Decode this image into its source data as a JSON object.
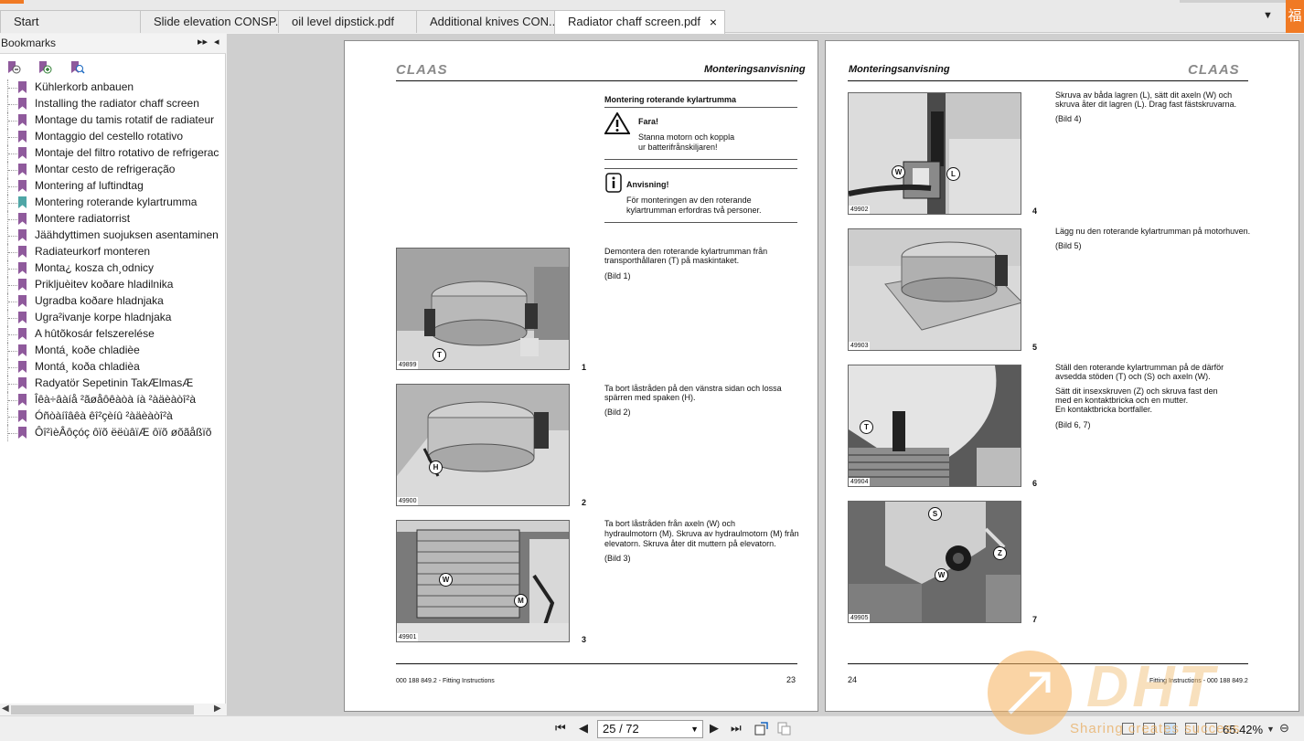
{
  "tabs": [
    {
      "label": "Start",
      "active": false
    },
    {
      "label": "Slide elevation CONSP...",
      "active": false
    },
    {
      "label": "oil level dipstick.pdf",
      "active": false
    },
    {
      "label": "Additional knives CON...",
      "active": false
    },
    {
      "label": "Radiator chaff screen.pdf",
      "active": true
    }
  ],
  "tab_close_icon": "×",
  "tab_list_icon": "▼",
  "brand_badge": "福",
  "sidebar": {
    "title": "Bookmarks",
    "expand_icon": "▸▸",
    "collapse_icon": "◂",
    "tools": [
      "bookmark-delete-icon",
      "bookmark-add-icon",
      "bookmark-find-icon"
    ],
    "items": [
      {
        "label": "Kühlerkorb anbauen"
      },
      {
        "label": "Installing the radiator chaff screen"
      },
      {
        "label": "Montage du tamis rotatif de radiateur"
      },
      {
        "label": "Montaggio del cestello rotativo"
      },
      {
        "label": "Montaje del filtro rotativo de refrigerac"
      },
      {
        "label": "Montar cesto de refrigeração"
      },
      {
        "label": "Montering af luftindtag"
      },
      {
        "label": "Montering roterande kylartrumma",
        "current": true
      },
      {
        "label": "Montere radiatorrist"
      },
      {
        "label": "Jäähdyttimen suojuksen asentaminen"
      },
      {
        "label": "Radiateurkorf monteren"
      },
      {
        "label": "Monta¿ kosza ch¸odnicy"
      },
      {
        "label": "Prikljuèitev koðare hladilnika"
      },
      {
        "label": "Ugradba koðare hladnjaka"
      },
      {
        "label": "Ugra²ivanje korpe hladnjaka"
      },
      {
        "label": "A hûtõkosár felszerelése"
      },
      {
        "label": "Montá¸ koðe chladièe"
      },
      {
        "label": "Montá¸ koða chladièa"
      },
      {
        "label": "Radyatör Sepetinin TakÆlmasÆ"
      },
      {
        "label": "Îêà÷âàíå ²ãøåôêàòà íà ²àäèàòî²à"
      },
      {
        "label": "Óñòàíîâêà êî²çèíû ²àäèàòî²à"
      },
      {
        "label": "Ôî²ìèÂôçóç ôïõ ëëùâïÆ ôïõ øõãåßïõ"
      }
    ]
  },
  "page_left": {
    "logo": "CLAAS",
    "header": "Monteringsanvisning",
    "section_title": "Montering roterande kylartrumma",
    "warning_title": "Fara!",
    "warning_text": [
      "Stanna motorn och koppla",
      "ur batterifrånskiljaren!"
    ],
    "note_title": "Anvisning!",
    "note_text": [
      "För monteringen av den roterande",
      "kylartrumman erfordras två personer."
    ],
    "steps": [
      {
        "text": [
          "Demontera den roterande kylartrumman från",
          "transporthållaren (T) på maskintaket."
        ],
        "ref": "(Bild 1)",
        "photo_id": "49899",
        "fig": "1",
        "callouts": [
          "T"
        ]
      },
      {
        "text": [
          "Ta bort låstråden på den vänstra sidan och lossa",
          "spärren med spaken (H)."
        ],
        "ref": "(Bild 2)",
        "photo_id": "49900",
        "fig": "2",
        "callouts": [
          "H"
        ]
      },
      {
        "text": [
          "Ta bort låstråden från axeln (W) och",
          "hydraulmotorn (M). Skruva av hydraulmotorn (M) från",
          "elevatorn. Skruva åter dit muttern på elevatorn."
        ],
        "ref": "(Bild 3)",
        "photo_id": "49901",
        "fig": "3",
        "callouts": [
          "W",
          "M"
        ]
      }
    ],
    "footer_left": "000 188 849.2 - Fitting Instructions",
    "page_number": "23"
  },
  "page_right": {
    "logo": "CLAAS",
    "header": "Monteringsanvisning",
    "steps": [
      {
        "text": [
          "Skruva av båda lagren (L), sätt dit axeln (W) och",
          "skruva åter dit lagren (L). Drag fast fästskruvarna."
        ],
        "ref": "(Bild 4)",
        "photo_id": "49902",
        "fig": "4",
        "callouts": [
          "W",
          "L"
        ]
      },
      {
        "text": [
          "Lägg nu den roterande kylartrumman på motorhuven."
        ],
        "ref": "(Bild 5)",
        "photo_id": "49903",
        "fig": "5",
        "callouts": []
      },
      {
        "text": [
          "Ställ den roterande kylartrumman på de därför",
          "avsedda stöden (T) och (S) och axeln (W).",
          "Sätt dit insexskruven (Z) och skruva fast den",
          "med en kontaktbricka och en mutter.",
          "En kontaktbricka bortfaller."
        ],
        "ref": "(Bild 6, 7)",
        "photo_id": "49904",
        "fig": "6",
        "callouts": [
          "T"
        ]
      },
      {
        "text": [],
        "ref": "",
        "photo_id": "49905",
        "fig": "7",
        "callouts": [
          "S",
          "Z",
          "W"
        ]
      }
    ],
    "page_number": "24",
    "footer_right": "Fitting Instructions - 000 188 849.2"
  },
  "statusbar": {
    "page_indicator": "25 / 72",
    "zoom": "65.42%",
    "first_icon": "⏮",
    "prev_icon": "◀",
    "next_icon": "▶",
    "last_icon": "⏭",
    "dropdown_icon": "▼",
    "zoom_minus": "⊖"
  },
  "watermark": {
    "logo": "DHT",
    "tagline": "Sharing creates success"
  },
  "colors": {
    "accent": "#f07a24",
    "bookmark_flag": "#8f5a9c",
    "bookmark_current": "#4fa6a6",
    "doc_background": "#cfcfcf"
  }
}
